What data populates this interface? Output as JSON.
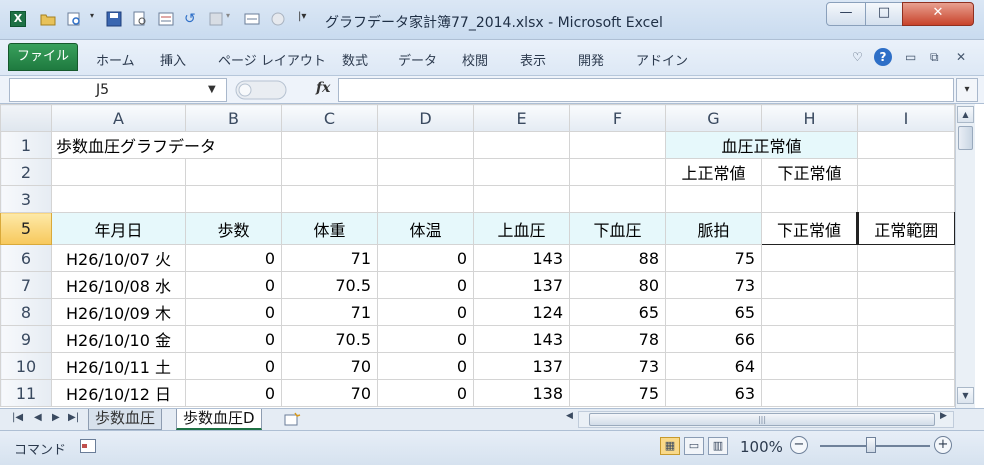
{
  "window": {
    "title": "グラフデータ家計簿77_2014.xlsx - Microsoft Excel",
    "minimize": "—",
    "maximize": "□",
    "close": "✕"
  },
  "quick_access": {
    "app_icon_letter": "X",
    "icons": [
      "open-icon",
      "print-preview-icon",
      "save-icon",
      "find-icon",
      "forms-icon",
      "undo-icon",
      "redo-icon",
      "customize-qat-icon"
    ]
  },
  "ribbon": {
    "file_tab": "ファイル",
    "tabs": [
      "ホーム",
      "挿入",
      "ページ レイアウト",
      "数式",
      "データ",
      "校閲",
      "表示",
      "開発",
      "アドイン"
    ]
  },
  "formula_bar": {
    "name_box": "J5",
    "fx_label": "fx",
    "formula": ""
  },
  "grid": {
    "columns": [
      "A",
      "B",
      "C",
      "D",
      "E",
      "F",
      "G",
      "H",
      "I"
    ],
    "rows": [
      {
        "num": "1",
        "cells": [
          "歩数血圧グラフデータ",
          "",
          "",
          "",
          "",
          "",
          "血圧正常値",
          "",
          ""
        ]
      },
      {
        "num": "2",
        "cells": [
          "",
          "",
          "",
          "",
          "",
          "",
          "上正常値",
          "下正常値",
          ""
        ]
      },
      {
        "num": "3",
        "cells": [
          "",
          "",
          "",
          "",
          "",
          "",
          "",
          "",
          ""
        ]
      },
      {
        "num": "5",
        "cells": [
          "年月日",
          "歩数",
          "体重",
          "体温",
          "上血圧",
          "下血圧",
          "脈拍",
          "下正常値",
          "正常範囲"
        ]
      },
      {
        "num": "6",
        "cells": [
          "H26/10/07 火",
          "0",
          "71",
          "0",
          "143",
          "88",
          "75",
          "",
          ""
        ]
      },
      {
        "num": "7",
        "cells": [
          "H26/10/08 水",
          "0",
          "70.5",
          "0",
          "137",
          "80",
          "73",
          "",
          ""
        ]
      },
      {
        "num": "8",
        "cells": [
          "H26/10/09 木",
          "0",
          "71",
          "0",
          "124",
          "65",
          "65",
          "",
          ""
        ]
      },
      {
        "num": "9",
        "cells": [
          "H26/10/10 金",
          "0",
          "70.5",
          "0",
          "143",
          "78",
          "66",
          "",
          ""
        ]
      },
      {
        "num": "10",
        "cells": [
          "H26/10/11 土",
          "0",
          "70",
          "0",
          "137",
          "73",
          "64",
          "",
          ""
        ]
      },
      {
        "num": "11",
        "cells": [
          "H26/10/12 日",
          "0",
          "70",
          "0",
          "138",
          "75",
          "63",
          "",
          ""
        ]
      }
    ]
  },
  "sheet_tabs": {
    "tabs": [
      "歩数血圧",
      "歩数血圧D"
    ],
    "active": "歩数血圧D"
  },
  "status_bar": {
    "mode": "コマンド",
    "zoom": "100%"
  }
}
